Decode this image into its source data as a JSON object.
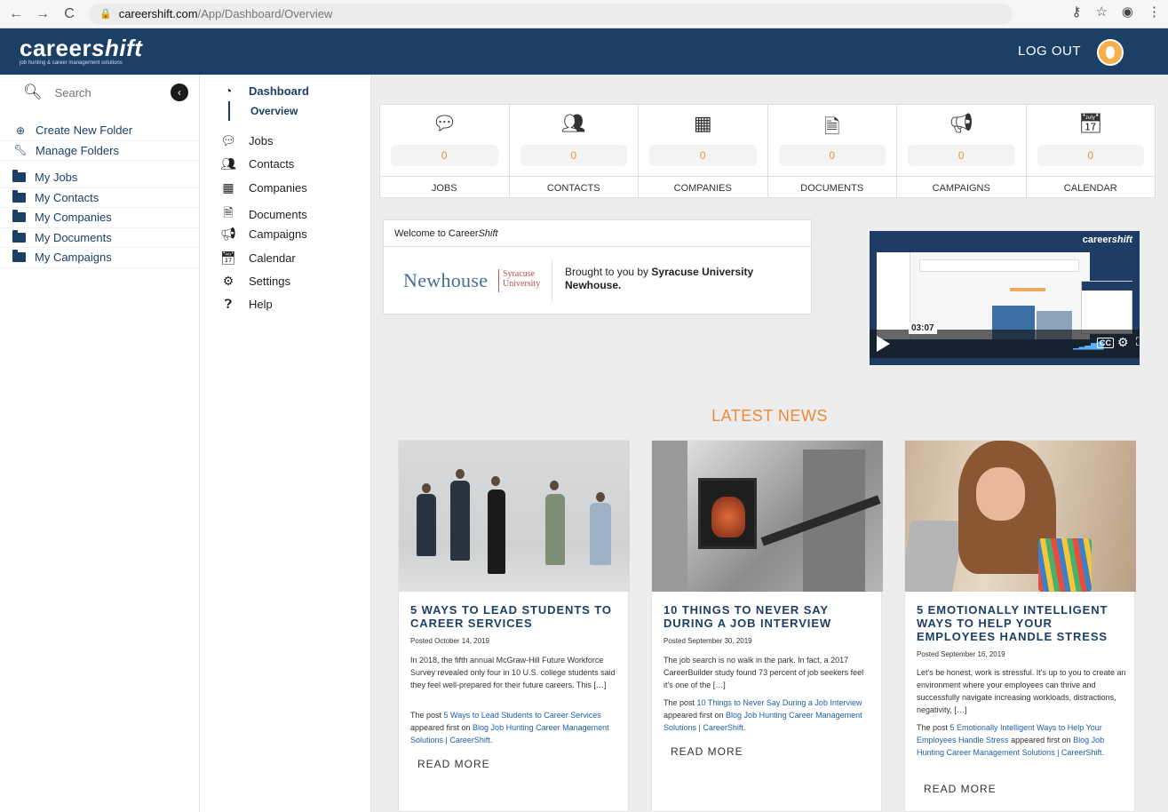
{
  "browser": {
    "url_host": "careershift.com",
    "url_path": "/App/Dashboard/Overview"
  },
  "header": {
    "logo_main_a": "career",
    "logo_main_b": "shift",
    "logo_sub": "job hunting & career management solutions",
    "logout": "LOG OUT"
  },
  "sidebar": {
    "search_placeholder": "Search",
    "create_folder": "Create New Folder",
    "manage_folders": "Manage Folders",
    "folders": [
      "My Jobs",
      "My Contacts",
      "My Companies",
      "My Documents",
      "My Campaigns"
    ]
  },
  "nav": {
    "dashboard": "Dashboard",
    "overview": "Overview",
    "items": [
      "Jobs",
      "Contacts",
      "Companies",
      "Documents",
      "Campaigns",
      "Calendar",
      "Settings",
      "Help"
    ]
  },
  "stats": [
    {
      "label": "JOBS",
      "value": "0",
      "icon": "speech-bubble-icon"
    },
    {
      "label": "CONTACTS",
      "value": "0",
      "icon": "people-icon"
    },
    {
      "label": "COMPANIES",
      "value": "0",
      "icon": "building-icon"
    },
    {
      "label": "DOCUMENTS",
      "value": "0",
      "icon": "document-icon"
    },
    {
      "label": "CAMPAIGNS",
      "value": "0",
      "icon": "megaphone-icon"
    },
    {
      "label": "CALENDAR",
      "value": "0",
      "icon": "calendar-icon"
    }
  ],
  "welcome": {
    "title_a": "Welcome to Career",
    "title_b": "Shift",
    "newhouse": "Newhouse",
    "syracuse_1": "Syracuse",
    "syracuse_2": "University",
    "brought_a": "Brought to you by ",
    "brought_b": "Syracuse University Newhouse."
  },
  "video": {
    "logo_a": "career",
    "logo_b": "shift",
    "time": "03:07",
    "cc": "CC"
  },
  "news": {
    "title": "LATEST NEWS",
    "read_more": "READ MORE",
    "cards": [
      {
        "headline": "5 WAYS TO LEAD STUDENTS TO CAREER SERVICES",
        "posted": "Posted October 14, 2019",
        "body": "In 2018, the fifth annual McGraw-Hill Future Workforce Survey revealed only four in 10 U.S. college students said they feel well-prepared for their future careers. This […]",
        "post_prefix": "The post ",
        "post_link": "5 Ways to Lead Students to Career Services",
        "post_mid": " appeared first on ",
        "post_site": "Blog Job Hunting Career Management Solutions | CareerShift",
        "post_end": "."
      },
      {
        "headline": "10 THINGS TO NEVER SAY DURING A JOB INTERVIEW",
        "posted": "Posted September 30, 2019",
        "body": "The job search is no walk in the park. In fact, a 2017 CareerBuilder study found 73 percent of job seekers feel it's one of the […]",
        "post_prefix": "The post ",
        "post_link": "10 Things to Never Say During a Job Interview",
        "post_mid": " appeared first on ",
        "post_site": "Blog Job Hunting Career Management Solutions | CareerShift",
        "post_end": "."
      },
      {
        "headline": "5 EMOTIONALLY INTELLIGENT WAYS TO HELP YOUR EMPLOYEES HANDLE STRESS",
        "posted": "Posted September 16, 2019",
        "body": "Let's be honest, work is stressful. It's up to you to create an environment where your employees can thrive and successfully navigate increasing workloads, distractions, negativity, […]",
        "post_prefix": "The post ",
        "post_link": "5 Emotionally Intelligent Ways to Help Your Employees Handle Stress",
        "post_mid": " appeared first on ",
        "post_site": "Blog Job Hunting Career Management Solutions | CareerShift",
        "post_end": "."
      }
    ]
  },
  "colors": {
    "brand_navy": "#1c3f66",
    "accent_orange": "#f08a38",
    "link_blue": "#1f5fa8"
  }
}
